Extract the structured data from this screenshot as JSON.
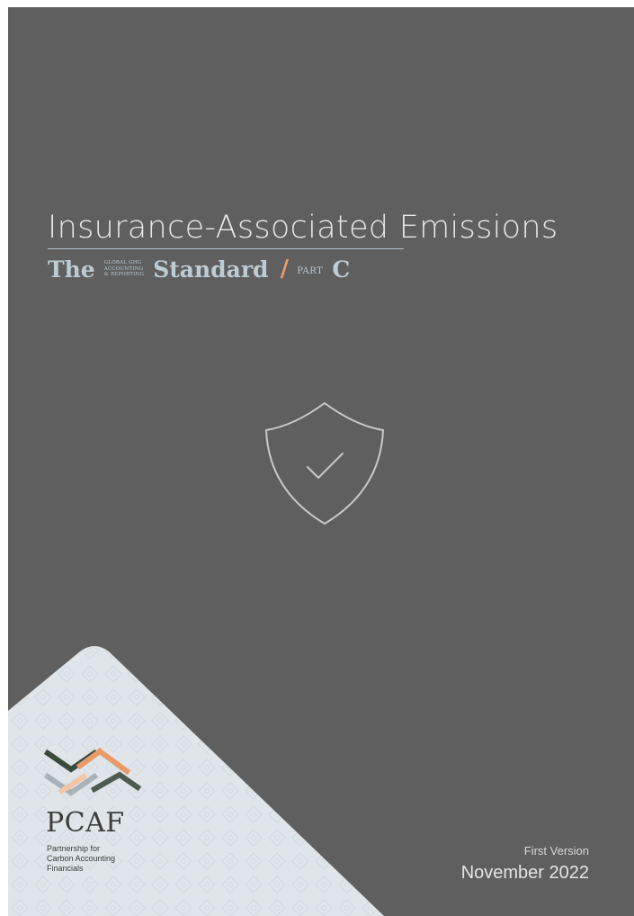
{
  "cover": {
    "title": "Insurance-Associated Emissions",
    "subtitle": {
      "the": "The",
      "small_line1": "GLOBAL GHG",
      "small_line2": "ACCOUNTING",
      "small_line3": "& REPORTING",
      "standard": "Standard",
      "part_word": "PART",
      "part_letter": "C"
    },
    "emblem_icon": "shield-check-icon",
    "logo": {
      "name": "PCAF",
      "line1": "Partnership for",
      "line2": "Carbon Accounting",
      "line3": "Financials"
    },
    "version_label": "First Version",
    "date": "November 2022"
  },
  "colors": {
    "background": "#5f5f5f",
    "title_text": "#e7e7e7",
    "subtitle_text": "#bccbd4",
    "accent_orange": "#e89a6a",
    "logo_panel": "#dfe5e8"
  }
}
